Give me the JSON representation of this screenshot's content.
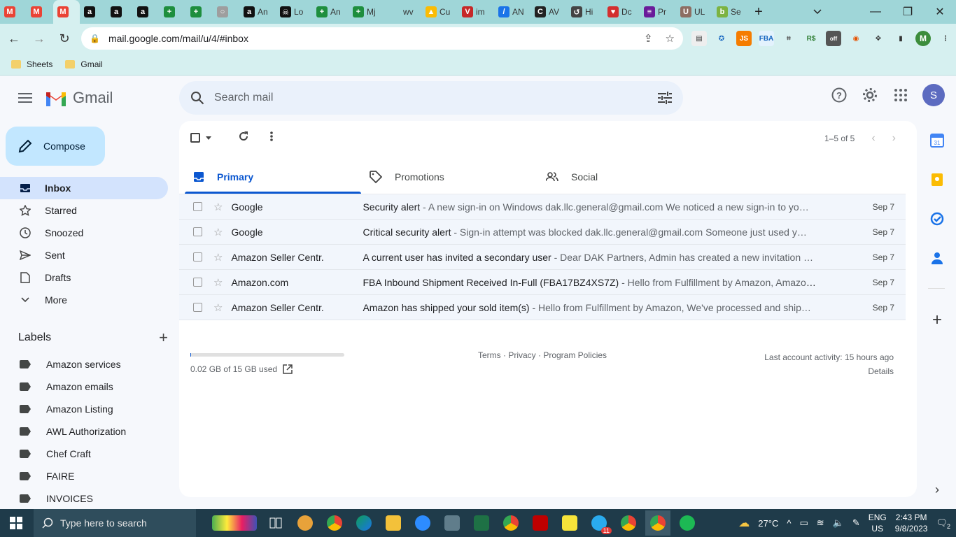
{
  "browser": {
    "tabs": [
      {
        "label": "",
        "fav": "M",
        "color": "#ea4335"
      },
      {
        "label": "",
        "fav": "M",
        "color": "#ea4335"
      },
      {
        "label": "",
        "fav": "M",
        "color": "#ea4335",
        "active": true
      },
      {
        "label": "",
        "fav": "a",
        "color": "#111111"
      },
      {
        "label": "",
        "fav": "a",
        "color": "#111111"
      },
      {
        "label": "",
        "fav": "a",
        "color": "#111111"
      },
      {
        "label": "",
        "fav": "+",
        "color": "#1e8e3e"
      },
      {
        "label": "",
        "fav": "+",
        "color": "#1e8e3e"
      },
      {
        "label": "",
        "fav": "○",
        "color": "#9e9e9e"
      },
      {
        "label": "An",
        "fav": "a",
        "color": "#111111"
      },
      {
        "label": "Lo",
        "fav": "☠",
        "color": "#111111"
      },
      {
        "label": "An",
        "fav": "+",
        "color": "#1e8e3e"
      },
      {
        "label": "Mj",
        "fav": "+",
        "color": "#1e8e3e"
      },
      {
        "label": "wv",
        "fav": "",
        "color": "#9fd6d8"
      },
      {
        "label": "Cu",
        "fav": "▲",
        "color": "#fbbc04"
      },
      {
        "label": "im",
        "fav": "V",
        "color": "#c62828"
      },
      {
        "label": "AN",
        "fav": "/",
        "color": "#1a73e8"
      },
      {
        "label": "AV",
        "fav": "C",
        "color": "#222222"
      },
      {
        "label": "Hi",
        "fav": "↺",
        "color": "#444444"
      },
      {
        "label": "Dc",
        "fav": "♥",
        "color": "#d32f2f"
      },
      {
        "label": "Pr",
        "fav": "≡",
        "color": "#6a1b9a"
      },
      {
        "label": "UL",
        "fav": "U",
        "color": "#8d6e63"
      },
      {
        "label": "Se",
        "fav": "b",
        "color": "#7cb342"
      }
    ],
    "url": "mail.google.com/mail/u/4/#inbox",
    "bookmarks": [
      "Sheets",
      "Gmail"
    ],
    "profile_initial": "M"
  },
  "gmail": {
    "brand": "Gmail",
    "search_placeholder": "Search mail",
    "avatar_initial": "S",
    "compose_label": "Compose",
    "nav": [
      {
        "label": "Inbox",
        "icon": "inbox-icon",
        "active": true
      },
      {
        "label": "Starred",
        "icon": "star-icon"
      },
      {
        "label": "Snoozed",
        "icon": "clock-icon"
      },
      {
        "label": "Sent",
        "icon": "send-icon"
      },
      {
        "label": "Drafts",
        "icon": "draft-icon"
      },
      {
        "label": "More",
        "icon": "chevron-down-icon"
      }
    ],
    "labels_heading": "Labels",
    "labels": [
      "Amazon services",
      "Amazon emails",
      "Amazon Listing",
      "AWL Authorization",
      "Chef Craft",
      "FAIRE",
      "INVOICES"
    ],
    "pager": "1–5 of 5",
    "tabs": [
      {
        "label": "Primary",
        "active": true
      },
      {
        "label": "Promotions"
      },
      {
        "label": "Social"
      }
    ],
    "emails": [
      {
        "sender": "Google",
        "subject": "Security alert",
        "snippet": " - A new sign-in on Windows dak.llc.general@gmail.com We noticed a new sign-in to yo…",
        "date": "Sep 7"
      },
      {
        "sender": "Google",
        "subject": "Critical security alert",
        "snippet": " - Sign-in attempt was blocked dak.llc.general@gmail.com Someone just used y…",
        "date": "Sep 7"
      },
      {
        "sender": "Amazon Seller Centr.",
        "subject": "A current user has invited a secondary user",
        "snippet": " - Dear DAK Partners, Admin has created a new invitation …",
        "date": "Sep 7"
      },
      {
        "sender": "Amazon.com",
        "subject": "FBA Inbound Shipment Received In-Full (FBA17BZ4XS7Z)",
        "snippet": " - Hello from Fulfillment by Amazon, Amazon …",
        "date": "Sep 7"
      },
      {
        "sender": "Amazon Seller Centr.",
        "subject": "Amazon has shipped your sold item(s)",
        "snippet": " - Hello from Fulfillment by Amazon, We've processed and ship…",
        "date": "Sep 7"
      }
    ],
    "footer": {
      "storage": "0.02 GB of 15 GB used",
      "storage_fraction": 0.0013,
      "policies": "Terms · Privacy · Program Policies",
      "activity": "Last account activity: 15 hours ago",
      "details": "Details"
    }
  },
  "taskbar": {
    "search_placeholder": "Type here to search",
    "weather": "27°C",
    "lang1": "ENG",
    "lang2": "US",
    "time": "2:43 PM",
    "date": "9/8/2023",
    "notif_count": "2",
    "telegram_badge": "11"
  }
}
